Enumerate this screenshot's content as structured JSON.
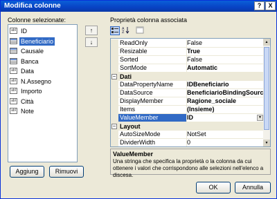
{
  "window": {
    "title": "Modifica colonne",
    "help_label": "?",
    "close_label": "X"
  },
  "left": {
    "columns_label": "Colonne selezionate:",
    "columns": [
      {
        "label": "ID",
        "icon": "abl"
      },
      {
        "label": "Beneficiario",
        "icon": "combo",
        "selected": true
      },
      {
        "label": "Causale",
        "icon": "combo"
      },
      {
        "label": "Banca",
        "icon": "combo"
      },
      {
        "label": "Data",
        "icon": "abl"
      },
      {
        "label": "N.Assegno",
        "icon": "abl"
      },
      {
        "label": "Importo",
        "icon": "abl"
      },
      {
        "label": "Città",
        "icon": "abl"
      },
      {
        "label": "Note",
        "icon": "abl"
      }
    ],
    "move_up_label": "↑",
    "move_down_label": "↓",
    "add_label": "Aggiung",
    "remove_label": "Rimuovi"
  },
  "right": {
    "props_label": "Proprietà colonna associata",
    "toolbar": [
      "categorized-icon",
      "alphabetical-icon",
      "property-pages-icon"
    ],
    "rows": [
      {
        "kind": "prop",
        "name": "ReadOnly",
        "value": "False",
        "bold": false
      },
      {
        "kind": "prop",
        "name": "Resizable",
        "value": "True",
        "bold": true
      },
      {
        "kind": "prop",
        "name": "Sorted",
        "value": "False",
        "bold": false
      },
      {
        "kind": "prop",
        "name": "SortMode",
        "value": "Automatic",
        "bold": true
      },
      {
        "kind": "cat",
        "name": "Dati",
        "toggle": "−"
      },
      {
        "kind": "prop",
        "name": "DataPropertyName",
        "value": "IDBeneficiario",
        "bold": true
      },
      {
        "kind": "prop",
        "name": "DataSource",
        "value": "BeneficiarioBindingSource",
        "bold": true
      },
      {
        "kind": "prop",
        "name": "DisplayMember",
        "value": "Ragione_sociale",
        "bold": true
      },
      {
        "kind": "prop",
        "name": "Items",
        "value": "(Insieme)",
        "bold": true
      },
      {
        "kind": "prop",
        "name": "ValueMember",
        "value": "ID",
        "bold": true,
        "selected": true
      },
      {
        "kind": "cat",
        "name": "Layout",
        "toggle": "−"
      },
      {
        "kind": "prop",
        "name": "AutoSizeMode",
        "value": "NotSet",
        "bold": false
      },
      {
        "kind": "prop",
        "name": "DividerWidth",
        "value": "0",
        "bold": false
      }
    ],
    "description_title": "ValueMember",
    "description_text": "Una stringa che specifica la proprietà o la colonna da cui ottenere i valori che corrispondono alle selezioni nell'elenco a discesa."
  },
  "footer": {
    "ok_label": "OK",
    "cancel_label": "Annulla"
  }
}
